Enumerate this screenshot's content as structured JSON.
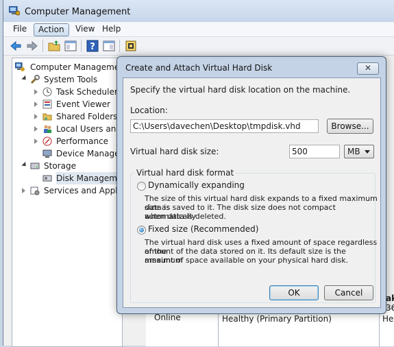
{
  "window": {
    "title": "Computer Management"
  },
  "menu": [
    "File",
    "Action",
    "View",
    "Help"
  ],
  "toolbar": {
    "icons": [
      "back-arrow-icon",
      "forward-arrow-icon",
      "up-folder-icon",
      "show-hide-tree-icon",
      "help-icon",
      "properties-icon",
      "console-icon"
    ]
  },
  "tree": {
    "root": "Computer Management",
    "items": [
      {
        "label": "System Tools",
        "icon": "tools-icon"
      },
      {
        "label": "Task Scheduler",
        "icon": "clock-icon"
      },
      {
        "label": "Event Viewer",
        "icon": "event-viewer-icon"
      },
      {
        "label": "Shared Folders",
        "icon": "shared-folder-icon"
      },
      {
        "label": "Local Users and G",
        "icon": "users-icon"
      },
      {
        "label": "Performance",
        "icon": "performance-icon"
      },
      {
        "label": "Device Manager",
        "icon": "device-manager-icon"
      },
      {
        "label": "Storage",
        "icon": "storage-icon"
      },
      {
        "label": "Disk Managemen",
        "icon": "disk-icon"
      },
      {
        "label": "Services and Applica",
        "icon": "services-icon"
      }
    ]
  },
  "background_pane": {
    "status": "Online",
    "volume_status": "Healthy (Primary Partition)",
    "edge_text_1": "ak",
    "edge_text_2": "36.",
    "edge_text_3": "Hea"
  },
  "dialog": {
    "title": "Create and Attach Virtual Hard Disk",
    "close_label": "✕",
    "instruction": "Specify the virtual hard disk location on the machine.",
    "location_label": "Location:",
    "location_value": "C:\\Users\\davechen\\Desktop\\tmpdisk.vhd",
    "browse_label": "Browse...",
    "size_label": "Virtual hard disk size:",
    "size_value": "500",
    "size_unit": "MB",
    "format_group_label": "Virtual hard disk format",
    "dynamic_label": "Dynamically expanding",
    "dynamic_desc": [
      "The size of this virtual hard disk expands to a fixed maximum size as",
      "data is saved to it.  The disk size does not compact automatically",
      "when data is deleted."
    ],
    "fixed_label": "Fixed size (Recommended)",
    "fixed_desc": [
      "The virtual hard disk uses a fixed amount of space regardless of the",
      "amount of the data stored on it.  Its default size is the maximum",
      "amount of space available on your physical hard disk."
    ],
    "selected_format": "fixed",
    "ok_label": "OK",
    "cancel_label": "Cancel"
  }
}
